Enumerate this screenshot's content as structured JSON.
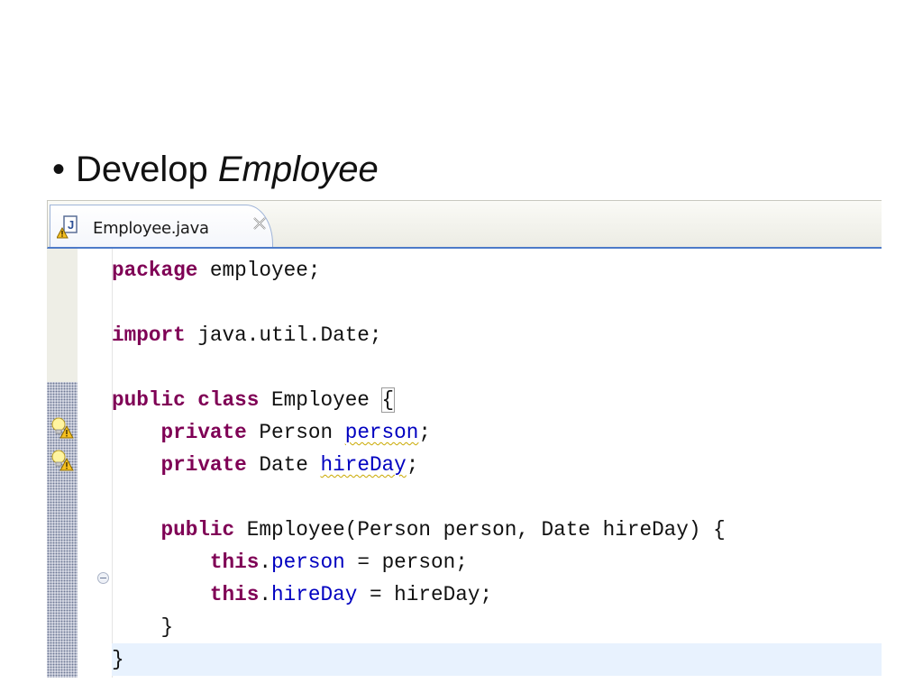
{
  "slide": {
    "bullet_text": "Develop ",
    "bullet_emphasis": "Employee"
  },
  "editor": {
    "tab_title": "Employee.java",
    "tab_icon": "java-file-warning-icon",
    "close_icon": "close-icon",
    "warning_icon": "warning-lightbulb-icon",
    "fold_icon": "collapse-fold-icon",
    "colors": {
      "keyword": "#7f0055",
      "field": "#0000c0",
      "current_line": "#e8f2fe",
      "tab_underline": "#4d7ac8"
    },
    "code": {
      "l1_kw": "package",
      "l1_rest": " employee;",
      "l2_kw": "import",
      "l2_rest": " java.util.Date;",
      "l3_kw": "public class",
      "l3_rest": " Employee ",
      "l3_brace": "{",
      "l4_indent": "    ",
      "l4_kw": "private",
      "l4_type": " Person ",
      "l4_field": "person",
      "l4_end": ";",
      "l5_indent": "    ",
      "l5_kw": "private",
      "l5_type": " Date ",
      "l5_field": "hireDay",
      "l5_end": ";",
      "l6_indent": "    ",
      "l6_kw": "public",
      "l6_rest": " Employee(Person person, Date hireDay) {",
      "l7_indent": "        ",
      "l7_kw": "this",
      "l7_dot": ".",
      "l7_field": "person",
      "l7_rest": " = person;",
      "l8_indent": "        ",
      "l8_kw": "this",
      "l8_dot": ".",
      "l8_field": "hireDay",
      "l8_rest": " = hireDay;",
      "l9_text": "    }",
      "l10_text": "}"
    }
  }
}
